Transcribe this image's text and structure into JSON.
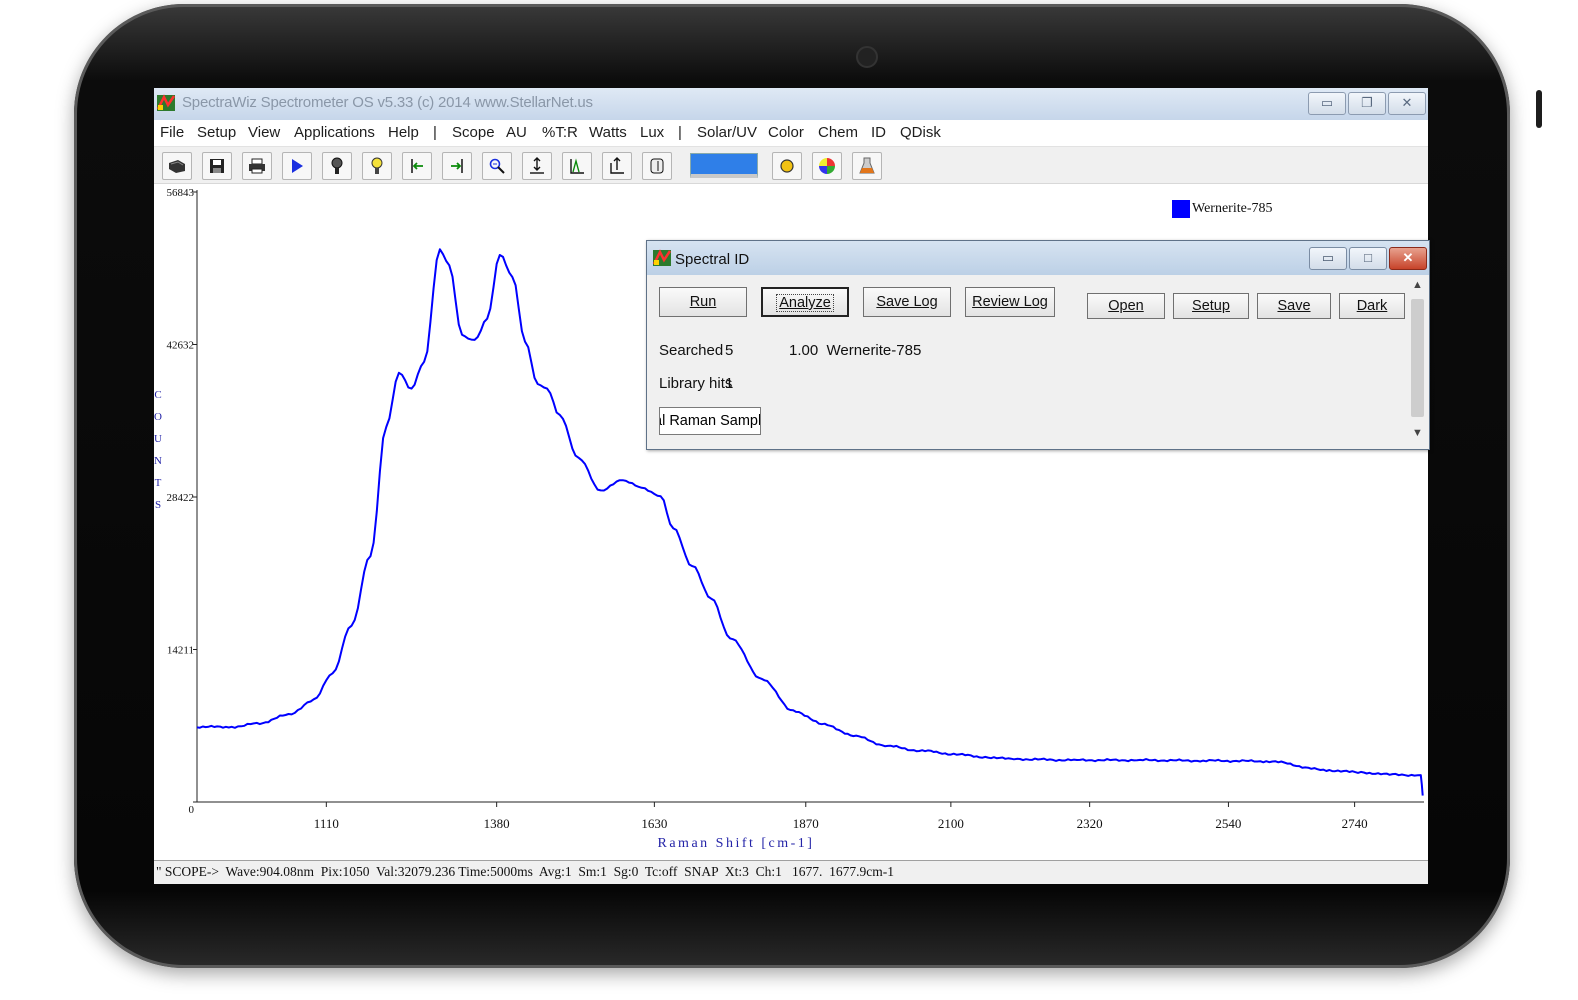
{
  "window": {
    "title": "SpectraWiz  Spectrometer OS v5.33 (c) 2014    www.StellarNet.us"
  },
  "menu": [
    "File",
    "Setup",
    "View",
    "Applications",
    "Help",
    "|",
    "Scope",
    "AU",
    "%T:R",
    "Watts",
    "Lux",
    "|",
    "Solar/UV",
    "Color",
    "Chem",
    "ID",
    "QDisk"
  ],
  "toolbar_icons": [
    "open-scope-icon",
    "save-icon",
    "print-icon",
    "play-icon",
    "probe-icon",
    "lamp-icon",
    "left-cursor-icon",
    "right-cursor-icon",
    "zoom-icon",
    "vertical-scale-icon",
    "peak-icon",
    "baseline-icon",
    "clear-icon",
    "color-swatch-icon",
    "sun-icon",
    "color-wheel-icon",
    "flask-icon"
  ],
  "legend": {
    "label": "Wernerite-785",
    "color": "#0000ff"
  },
  "status_bar": "\" SCOPE->  Wave:904.08nm  Pix:1050  Val:32079.236 Time:5000ms  Avg:1  Sm:1  Sg:0  Tc:off  SNAP  Xt:3  Ch:1   1677.  1677.9cm-1",
  "dialog": {
    "title": "Spectral ID",
    "buttons": {
      "run": "Run",
      "analyze": "Analyze",
      "save_log": "Save Log",
      "review_log": "Review Log",
      "open": "Open",
      "setup": "Setup",
      "save": "Save",
      "dark": "Dark"
    },
    "searched_label": "Searched",
    "searched_value": "5",
    "result": "1.00  Wernerite-785",
    "library_hits_label": "Library hits",
    "library_hits_value": "1",
    "library_field": "al Raman Samples"
  },
  "chart_data": {
    "type": "line",
    "xlabel": "Raman Shift [cm-1]",
    "ylabel": "COUNTS",
    "xlim": [
      905,
      2850
    ],
    "ylim": [
      0,
      56843
    ],
    "x_ticks": [
      1110,
      1380,
      1630,
      1870,
      2100,
      2320,
      2540,
      2740
    ],
    "y_ticks": [
      0,
      14211,
      28422,
      42632,
      56843
    ],
    "series": [
      {
        "name": "Wernerite-785",
        "color": "#0000ff",
        "x": [
          905,
          960,
          1000,
          1050,
          1090,
          1120,
          1150,
          1180,
          1205,
          1225,
          1245,
          1265,
          1290,
          1305,
          1325,
          1345,
          1365,
          1385,
          1405,
          1425,
          1445,
          1460,
          1480,
          1510,
          1545,
          1580,
          1610,
          1640,
          1660,
          1690,
          1720,
          1750,
          1800,
          1850,
          1900,
          1950,
          2000,
          2050,
          2100,
          2150,
          2200,
          2300,
          2400,
          2500,
          2600,
          2700,
          2750,
          2800,
          2845,
          2848
        ],
        "y": [
          7000,
          7000,
          7300,
          8100,
          9500,
          12000,
          16500,
          23000,
          35000,
          40000,
          38500,
          41000,
          51500,
          50000,
          43500,
          43000,
          45000,
          51000,
          49000,
          43000,
          39000,
          38500,
          36000,
          32000,
          29000,
          30000,
          29300,
          28500,
          25500,
          22000,
          19000,
          15300,
          11500,
          8500,
          7200,
          6100,
          5200,
          4800,
          4500,
          4200,
          4000,
          3900,
          3900,
          3850,
          3800,
          2950,
          2750,
          2550,
          2500,
          600
        ]
      }
    ]
  }
}
